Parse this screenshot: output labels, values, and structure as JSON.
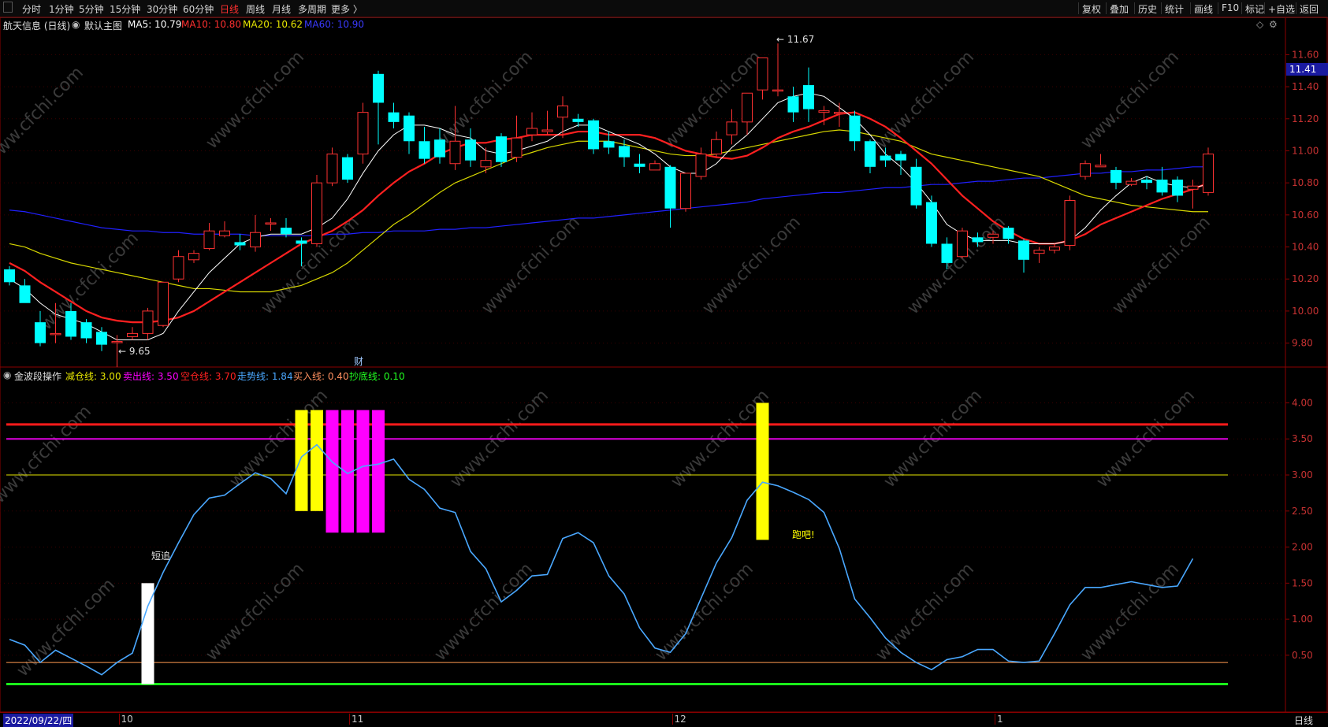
{
  "toolbar": {
    "left_items": [
      "分时",
      "1分钟",
      "5分钟",
      "15分钟",
      "30分钟",
      "60分钟",
      "日线",
      "周线",
      "月线",
      "多周期",
      "更多 〉"
    ],
    "active_index": 6,
    "right_items": [
      "复权",
      "叠加",
      "历史",
      "统计",
      "画线",
      "F10",
      "标记",
      "+自选",
      "返回"
    ]
  },
  "main_header": {
    "stock": "航天信息 (日线)",
    "template": "默认主图",
    "ma5": "MA5: 10.79",
    "ma10": "MA10: 10.80",
    "ma20": "MA20: 10.62",
    "ma60": "MA60: 10.90"
  },
  "indicator_header": {
    "name": "金波段操作",
    "l1": "减仓线: 3.00",
    "l2": "卖出线: 3.50",
    "l3": "空仓线: 3.70",
    "l4": "走势线: 1.84",
    "l5": "买入线: 0.40",
    "l6": "抄底线: 0.10"
  },
  "price_axis": [
    "11.60",
    "11.40",
    "11.20",
    "11.00",
    "10.80",
    "10.60",
    "10.40",
    "10.20",
    "10.00",
    "9.80"
  ],
  "current_price": "11.41",
  "ind_axis": [
    "4.00",
    "3.50",
    "3.00",
    "2.50",
    "2.00",
    "1.50",
    "1.00",
    "0.50"
  ],
  "annotations": {
    "high": "11.67",
    "low": "9.65",
    "finance": "财",
    "chase": "短追",
    "run": "跑吧!"
  },
  "bottom": {
    "date": "2022/09/22/四",
    "months": [
      "10",
      "11",
      "12",
      "1"
    ],
    "period": "日线"
  },
  "watermark": "www.cfchi.com",
  "colors": {
    "up": "#ff3232",
    "down": "#00ffff",
    "ma5": "#ffffff",
    "ma10": "#ff2020",
    "ma20": "#d8d800",
    "ma60": "#2020ff",
    "trend": "#4aa8ff"
  },
  "chart_data": {
    "type": "candlestick",
    "candles": [
      [
        10.26,
        10.28,
        10.18,
        10.16
      ],
      [
        10.16,
        10.2,
        10.05,
        10.08
      ],
      [
        9.93,
        10.0,
        9.8,
        9.78
      ],
      [
        9.86,
        10.05,
        9.86,
        9.8
      ],
      [
        10.0,
        10.05,
        9.84,
        9.82
      ],
      [
        9.93,
        9.95,
        9.83,
        9.8
      ],
      [
        9.87,
        9.9,
        9.79,
        9.75
      ],
      [
        9.81,
        9.85,
        9.81,
        9.65
      ],
      [
        9.84,
        9.9,
        9.86,
        9.82
      ],
      [
        9.86,
        10.02,
        10.0,
        9.82
      ],
      [
        9.91,
        10.18,
        10.18,
        9.9
      ],
      [
        10.2,
        10.38,
        10.34,
        10.18
      ],
      [
        10.32,
        10.38,
        10.36,
        10.3
      ],
      [
        10.39,
        10.55,
        10.5,
        10.38
      ],
      [
        10.47,
        10.56,
        10.5,
        10.46
      ],
      [
        10.43,
        10.48,
        10.41,
        10.38
      ],
      [
        10.4,
        10.6,
        10.49,
        10.37
      ],
      [
        10.55,
        10.58,
        10.55,
        10.5
      ],
      [
        10.52,
        10.58,
        10.48,
        10.46
      ],
      [
        10.44,
        10.46,
        10.42,
        10.28
      ],
      [
        10.42,
        10.85,
        10.8,
        10.4
      ],
      [
        10.8,
        11.02,
        10.98,
        10.78
      ],
      [
        10.96,
        10.98,
        10.82,
        10.8
      ],
      [
        10.98,
        11.3,
        11.24,
        10.92
      ],
      [
        11.48,
        11.5,
        11.3,
        11.04
      ],
      [
        11.24,
        11.3,
        11.18,
        11.14
      ],
      [
        11.22,
        11.24,
        11.06,
        10.98
      ],
      [
        11.06,
        11.15,
        10.95,
        10.92
      ],
      [
        11.07,
        11.14,
        10.96,
        10.92
      ],
      [
        10.92,
        11.28,
        11.06,
        10.88
      ],
      [
        11.07,
        11.14,
        10.94,
        10.9
      ],
      [
        10.9,
        11.02,
        10.94,
        10.86
      ],
      [
        11.09,
        11.11,
        10.93,
        10.9
      ],
      [
        10.96,
        11.22,
        11.08,
        10.93
      ],
      [
        11.1,
        11.24,
        11.14,
        11.06
      ],
      [
        11.12,
        11.25,
        11.13,
        11.1
      ],
      [
        11.21,
        11.34,
        11.28,
        11.08
      ],
      [
        11.2,
        11.23,
        11.18,
        11.15
      ],
      [
        11.19,
        11.2,
        11.01,
        10.98
      ],
      [
        11.06,
        11.12,
        11.02,
        10.98
      ],
      [
        11.03,
        11.07,
        10.96,
        10.9
      ],
      [
        10.92,
        10.98,
        10.9,
        10.86
      ],
      [
        10.88,
        10.94,
        10.92,
        10.88
      ],
      [
        10.9,
        10.91,
        10.64,
        10.52
      ],
      [
        10.64,
        10.86,
        10.86,
        10.62
      ],
      [
        10.84,
        11.02,
        10.98,
        10.82
      ],
      [
        10.98,
        11.12,
        11.07,
        10.96
      ],
      [
        11.1,
        11.26,
        11.18,
        11.04
      ],
      [
        11.18,
        11.33,
        11.36,
        11.1
      ],
      [
        11.38,
        11.58,
        11.58,
        11.32
      ],
      [
        11.38,
        11.67,
        11.38,
        11.34
      ],
      [
        11.34,
        11.4,
        11.24,
        11.18
      ],
      [
        11.41,
        11.52,
        11.26,
        11.18
      ],
      [
        11.24,
        11.28,
        11.25,
        11.16
      ],
      [
        11.24,
        11.3,
        11.24,
        11.15
      ],
      [
        11.22,
        11.25,
        11.06,
        11.0
      ],
      [
        11.06,
        11.07,
        10.9,
        10.86
      ],
      [
        10.97,
        11.02,
        10.94,
        10.9
      ],
      [
        10.98,
        11.0,
        10.94,
        10.85
      ],
      [
        10.9,
        10.95,
        10.66,
        10.64
      ],
      [
        10.68,
        10.72,
        10.42,
        10.4
      ],
      [
        10.42,
        10.46,
        10.3,
        10.26
      ],
      [
        10.34,
        10.52,
        10.5,
        10.33
      ],
      [
        10.46,
        10.49,
        10.43,
        10.4
      ],
      [
        10.46,
        10.5,
        10.48,
        10.42
      ],
      [
        10.52,
        10.53,
        10.45,
        10.42
      ],
      [
        10.44,
        10.45,
        10.32,
        10.24
      ],
      [
        10.36,
        10.4,
        10.38,
        10.3
      ],
      [
        10.38,
        10.42,
        10.4,
        10.36
      ],
      [
        10.41,
        10.72,
        10.69,
        10.38
      ],
      [
        10.84,
        10.94,
        10.92,
        10.82
      ],
      [
        10.9,
        10.98,
        10.91,
        10.9
      ],
      [
        10.88,
        10.9,
        10.8,
        10.76
      ],
      [
        10.79,
        10.83,
        10.81,
        10.78
      ],
      [
        10.82,
        10.84,
        10.8,
        10.76
      ],
      [
        10.82,
        10.9,
        10.74,
        10.72
      ],
      [
        10.82,
        10.84,
        10.72,
        10.68
      ],
      [
        10.76,
        10.82,
        10.78,
        10.64
      ],
      [
        10.74,
        11.02,
        10.98,
        10.72
      ]
    ],
    "ma5": [
      10.2,
      10.14,
      10.05,
      9.98,
      9.95,
      9.92,
      9.87,
      9.82,
      9.82,
      9.82,
      9.86,
      10.0,
      10.12,
      10.24,
      10.33,
      10.42,
      10.46,
      10.48,
      10.48,
      10.48,
      10.52,
      10.58,
      10.7,
      10.86,
      11.0,
      11.1,
      11.16,
      11.16,
      11.14,
      11.1,
      11.08,
      11.0,
      10.98,
      11.0,
      11.03,
      11.06,
      11.12,
      11.16,
      11.16,
      11.12,
      11.08,
      11.04,
      10.98,
      10.9,
      10.86,
      10.86,
      10.92,
      11.02,
      11.1,
      11.2,
      11.3,
      11.34,
      11.36,
      11.34,
      11.27,
      11.2,
      11.1,
      10.98,
      10.9,
      10.8,
      10.68,
      10.54,
      10.48,
      10.44,
      10.44,
      10.44,
      10.42,
      10.42,
      10.42,
      10.44,
      10.52,
      10.63,
      10.72,
      10.8,
      10.84,
      10.8,
      10.78,
      10.77,
      10.79
    ],
    "ma10": [
      10.3,
      10.25,
      10.18,
      10.12,
      10.06,
      10.0,
      9.96,
      9.94,
      9.93,
      9.93,
      9.94,
      9.96,
      10.0,
      10.06,
      10.12,
      10.18,
      10.24,
      10.3,
      10.36,
      10.42,
      10.46,
      10.5,
      10.56,
      10.63,
      10.72,
      10.8,
      10.87,
      10.92,
      10.98,
      11.02,
      11.05,
      11.05,
      11.07,
      11.08,
      11.1,
      11.1,
      11.1,
      11.12,
      11.12,
      11.1,
      11.1,
      11.1,
      11.08,
      11.04,
      11.0,
      10.98,
      10.96,
      10.95,
      10.97,
      11.02,
      11.08,
      11.12,
      11.15,
      11.19,
      11.23,
      11.24,
      11.2,
      11.15,
      11.08,
      11.0,
      10.92,
      10.82,
      10.72,
      10.64,
      10.56,
      10.5,
      10.45,
      10.42,
      10.42,
      10.44,
      10.48,
      10.54,
      10.58,
      10.62,
      10.66,
      10.7,
      10.73,
      10.76,
      10.8
    ],
    "ma20": [
      10.42,
      10.4,
      10.36,
      10.33,
      10.3,
      10.28,
      10.26,
      10.24,
      10.22,
      10.2,
      10.18,
      10.16,
      10.14,
      10.14,
      10.13,
      10.12,
      10.12,
      10.12,
      10.14,
      10.16,
      10.2,
      10.24,
      10.3,
      10.38,
      10.46,
      10.54,
      10.6,
      10.67,
      10.74,
      10.8,
      10.84,
      10.88,
      10.92,
      10.96,
      10.99,
      11.02,
      11.04,
      11.06,
      11.06,
      11.06,
      11.04,
      11.02,
      11.0,
      10.98,
      10.97,
      10.97,
      10.98,
      11.0,
      11.02,
      11.04,
      11.06,
      11.08,
      11.1,
      11.12,
      11.13,
      11.12,
      11.1,
      11.08,
      11.06,
      11.02,
      10.98,
      10.96,
      10.94,
      10.92,
      10.9,
      10.88,
      10.86,
      10.84,
      10.8,
      10.76,
      10.72,
      10.7,
      10.68,
      10.66,
      10.65,
      10.64,
      10.63,
      10.62,
      10.62
    ],
    "ma60": [
      10.63,
      10.62,
      10.6,
      10.58,
      10.56,
      10.54,
      10.52,
      10.51,
      10.5,
      10.5,
      10.49,
      10.49,
      10.48,
      10.48,
      10.48,
      10.48,
      10.47,
      10.47,
      10.47,
      10.47,
      10.47,
      10.48,
      10.48,
      10.49,
      10.49,
      10.5,
      10.5,
      10.5,
      10.51,
      10.51,
      10.52,
      10.52,
      10.53,
      10.54,
      10.55,
      10.56,
      10.57,
      10.58,
      10.58,
      10.59,
      10.6,
      10.61,
      10.62,
      10.63,
      10.64,
      10.65,
      10.66,
      10.67,
      10.68,
      10.7,
      10.71,
      10.72,
      10.73,
      10.74,
      10.74,
      10.75,
      10.76,
      10.77,
      10.77,
      10.78,
      10.79,
      10.79,
      10.8,
      10.81,
      10.81,
      10.82,
      10.83,
      10.83,
      10.84,
      10.85,
      10.86,
      10.86,
      10.87,
      10.87,
      10.88,
      10.88,
      10.89,
      10.9,
      10.9
    ],
    "trend": [
      0.72,
      0.64,
      0.4,
      0.57,
      0.46,
      0.35,
      0.23,
      0.4,
      0.53,
      1.18,
      1.65,
      2.06,
      2.45,
      2.68,
      2.72,
      2.88,
      3.03,
      2.95,
      2.74,
      3.25,
      3.42,
      3.18,
      3.02,
      3.12,
      3.15,
      3.22,
      2.94,
      2.8,
      2.54,
      2.48,
      1.94,
      1.7,
      1.24,
      1.4,
      1.6,
      1.62,
      2.12,
      2.2,
      2.06,
      1.6,
      1.35,
      0.88,
      0.6,
      0.54,
      0.8,
      1.29,
      1.78,
      2.13,
      2.65,
      2.9,
      2.85,
      2.76,
      2.66,
      2.48,
      1.98,
      1.28,
      1.02,
      0.74,
      0.54,
      0.4,
      0.3,
      0.44,
      0.48,
      0.58,
      0.58,
      0.42,
      0.4,
      0.42,
      0.8,
      1.2,
      1.44,
      1.44,
      1.48,
      1.52,
      1.48,
      1.44,
      1.46,
      1.84
    ],
    "levels": {
      "jiancang": 3.0,
      "maichu": 3.5,
      "kongcang": 3.7,
      "mairu": 0.4,
      "chaodi": 0.1
    },
    "signal_bars": [
      {
        "i": 9,
        "from": 0.1,
        "to": 1.5,
        "color": "#ffffff"
      },
      {
        "i": 19,
        "from": 2.5,
        "to": 3.9,
        "color": "#ffff00"
      },
      {
        "i": 20,
        "from": 2.5,
        "to": 3.9,
        "color": "#ffff00"
      },
      {
        "i": 21,
        "from": 2.2,
        "to": 3.9,
        "color": "#ff00ff"
      },
      {
        "i": 22,
        "from": 2.2,
        "to": 3.9,
        "color": "#ff00ff"
      },
      {
        "i": 23,
        "from": 2.2,
        "to": 3.9,
        "color": "#ff00ff"
      },
      {
        "i": 24,
        "from": 2.2,
        "to": 3.9,
        "color": "#ff00ff"
      },
      {
        "i": 49,
        "from": 2.1,
        "to": 4.0,
        "color": "#ffff00"
      }
    ]
  }
}
